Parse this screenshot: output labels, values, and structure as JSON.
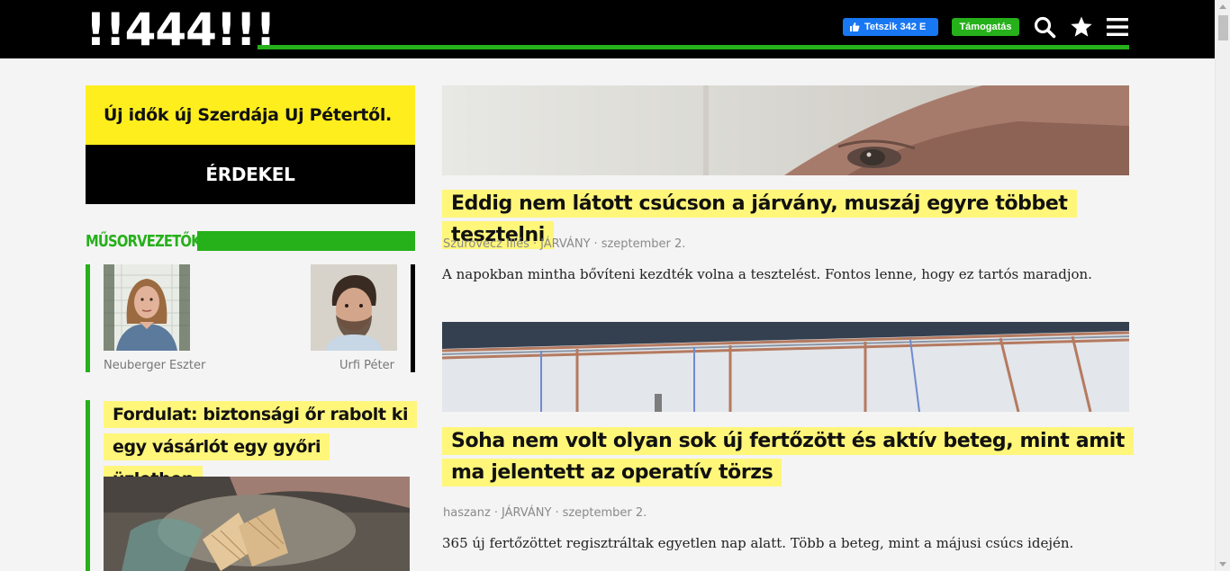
{
  "header": {
    "logo_text": "!!444!!!",
    "fb_like_label": "Tetszik 342 E",
    "support_label": "Támogatás",
    "icons": [
      "thumbs-up-icon",
      "search-icon",
      "star-icon",
      "menu-icon"
    ]
  },
  "promo": {
    "title": "Új idők új Szerdája Uj Pétertől.",
    "button_label": "ÉRDEKEL"
  },
  "hosts": {
    "section_title": "MŰSORVEZETŐK",
    "items": [
      {
        "name": "Neuberger Eszter"
      },
      {
        "name": "Urfi Péter"
      }
    ]
  },
  "side_article": {
    "headline": "Fordulat: biztonsági őr rabolt ki egy vásárlót egy győri üzletben"
  },
  "articles": [
    {
      "headline": "Eddig nem látott csúcson a járvány, muszáj egyre többet tesztelni",
      "author": "Szurovecz Illés",
      "section": "JÁRVÁNY",
      "date": "szeptember 2.",
      "lead": "A napokban mintha bővíteni kezdték volna a tesztelést. Fontos lenne, hogy ez tartós maradjon."
    },
    {
      "headline": "Soha nem volt olyan sok új fertőzött és aktív beteg, mint amit ma jelentett az operatív törzs",
      "author": "haszanz",
      "section": "JÁRVÁNY",
      "date": "szeptember 2.",
      "lead": "365 új fertőzöttet regisztráltak egyetlen nap alatt. Több a beteg, mint a májusi csúcs idején."
    }
  ],
  "colors": {
    "brand_green": "#26b01a",
    "highlight_yellow": "#fff67a",
    "promo_yellow": "#ffee1e",
    "facebook_blue": "#1877f2"
  }
}
